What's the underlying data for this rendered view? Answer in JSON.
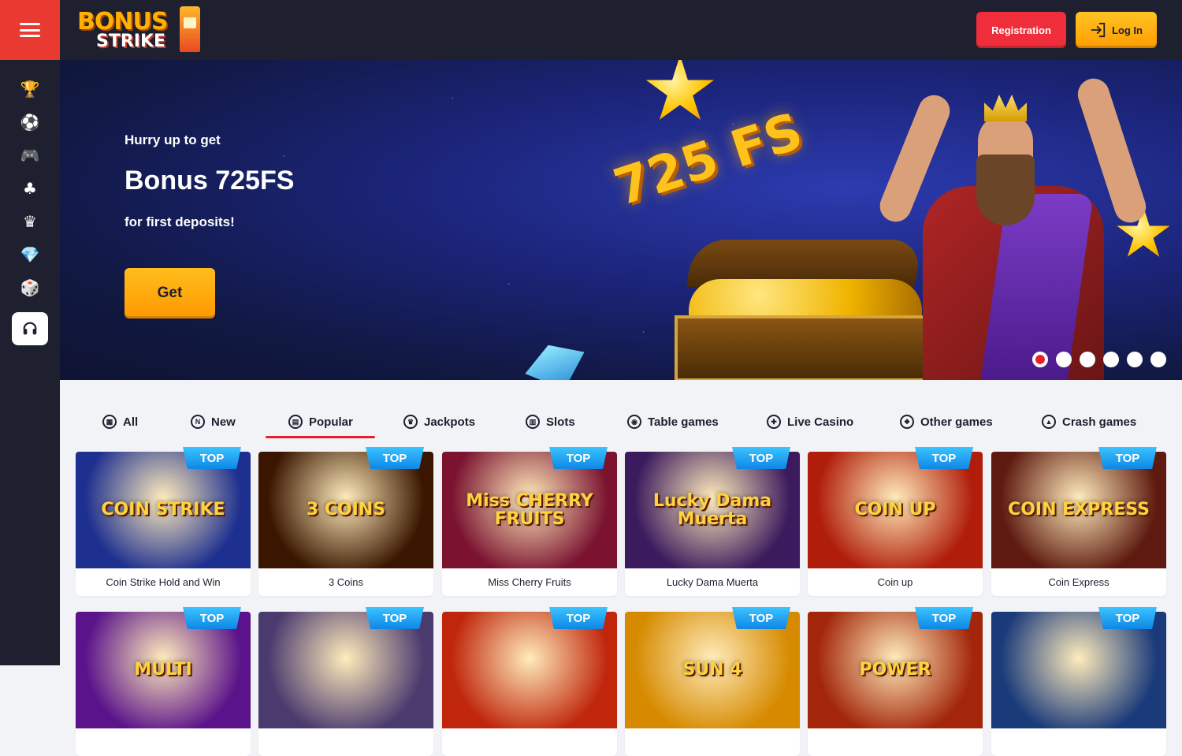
{
  "brand": {
    "logo_line1": "BONUS",
    "logo_line2": "STRIKE"
  },
  "header": {
    "registration_label": "Registration",
    "login_label": "Log In"
  },
  "sidebar": {
    "items": [
      {
        "name": "trophy-icon",
        "glyph": "🏆"
      },
      {
        "name": "soccer-ball-icon",
        "glyph": "⚽"
      },
      {
        "name": "gamepad-icon",
        "glyph": "🎮"
      },
      {
        "name": "clover-icon",
        "glyph": "♣"
      },
      {
        "name": "crown-icon",
        "glyph": "♛"
      },
      {
        "name": "diamond-icon",
        "glyph": "💎"
      },
      {
        "name": "dice-icon",
        "glyph": "🎲"
      }
    ],
    "support_icon": "headset-icon"
  },
  "banner": {
    "small_text": "Hurry up to get",
    "title": "Bonus 725FS",
    "subtitle": "for first deposits!",
    "cta_label": "Get",
    "promo_art_text": "725 FS",
    "slides_count": 6,
    "active_slide": 1
  },
  "tabs": [
    {
      "label": "All",
      "icon": "grid-icon",
      "glyph": "▦"
    },
    {
      "label": "New",
      "icon": "new-icon",
      "glyph": "N"
    },
    {
      "label": "Popular",
      "icon": "popular-icon",
      "glyph": "▤"
    },
    {
      "label": "Jackpots",
      "icon": "jackpot-crown-icon",
      "glyph": "♛"
    },
    {
      "label": "Slots",
      "icon": "slots-icon",
      "glyph": "▥"
    },
    {
      "label": "Table games",
      "icon": "chip-icon",
      "glyph": "◉"
    },
    {
      "label": "Live Casino",
      "icon": "live-icon",
      "glyph": "✚"
    },
    {
      "label": "Other games",
      "icon": "other-games-icon",
      "glyph": "❖"
    },
    {
      "label": "Crash games",
      "icon": "crash-icon",
      "glyph": "▲"
    }
  ],
  "active_tab": "Popular",
  "badge_label": "TOP",
  "games_row1": [
    {
      "title": "Coin Strike Hold and Win",
      "art": "COIN STRIKE",
      "bg": "#1d2f8f"
    },
    {
      "title": "3 Coins",
      "art": "3 COINS",
      "bg": "#3a1600"
    },
    {
      "title": "Miss Cherry Fruits",
      "art": "Miss CHERRY FRUITS",
      "bg": "#7a1230"
    },
    {
      "title": "Lucky Dama Muerta",
      "art": "Lucky Dama Muerta",
      "bg": "#3b1a5e"
    },
    {
      "title": "Coin up",
      "art": "COIN UP",
      "bg": "#b01d0a"
    },
    {
      "title": "Coin Express",
      "art": "COIN EXPRESS",
      "bg": "#5e1a10"
    }
  ],
  "games_row2": [
    {
      "art": "MULTI",
      "bg": "#5a138a"
    },
    {
      "art": "",
      "bg": "#4a3a6e"
    },
    {
      "art": "",
      "bg": "#c0260c"
    },
    {
      "art": "SUN 4",
      "bg": "#d68a00"
    },
    {
      "art": "POWER",
      "bg": "#a3260a"
    },
    {
      "art": "",
      "bg": "#1a3a7a"
    }
  ],
  "colors": {
    "accent_red": "#e8202d",
    "accent_orange": "#ff9d00",
    "dark_bg": "#1e1f2f",
    "badge_blue": "#0e87e6"
  }
}
